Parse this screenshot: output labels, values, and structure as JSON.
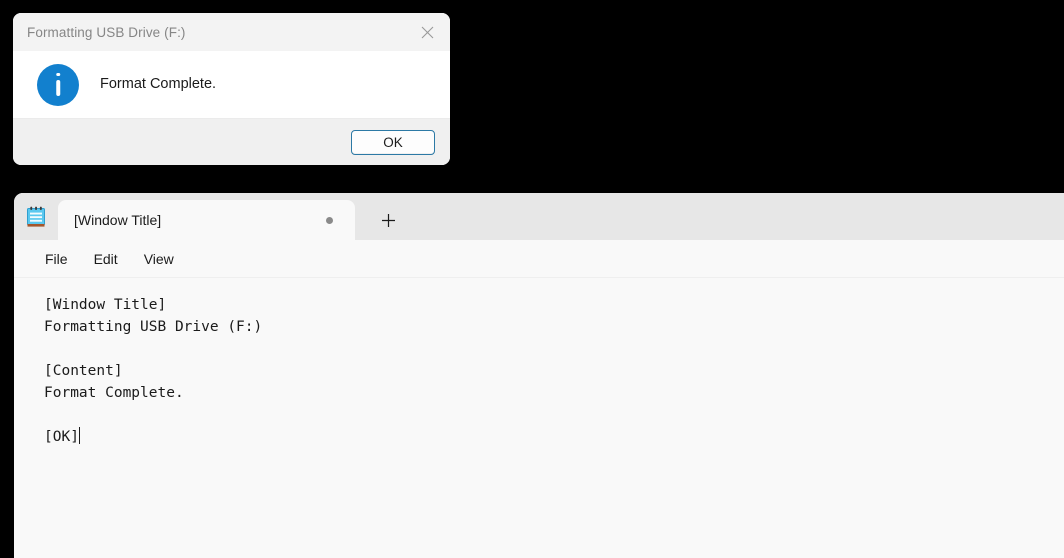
{
  "desktop": {
    "background_color": "#000000"
  },
  "dialog": {
    "title": "Formatting USB Drive (F:)",
    "close_icon": "close-icon",
    "icon": "info-icon",
    "message": "Format Complete.",
    "ok_label": "OK",
    "accent_color": "#1280ce",
    "focus_border_color": "#2c79a5",
    "titlebar_color": "#f3f3f3",
    "footer_color": "#f0f0f0"
  },
  "notepad": {
    "app_icon": "notepad-icon",
    "tabs": [
      {
        "label": "[Window Title]",
        "unsaved": true,
        "unsaved_indicator": "unsaved-dot"
      }
    ],
    "new_tab_icon": "plus-icon",
    "menu": [
      {
        "label": "File"
      },
      {
        "label": "Edit"
      },
      {
        "label": "View"
      }
    ],
    "editor": {
      "content": "[Window Title]\nFormatting USB Drive (F:)\n\n[Content]\nFormat Complete.\n\n[OK]",
      "caret_visible": true
    }
  }
}
